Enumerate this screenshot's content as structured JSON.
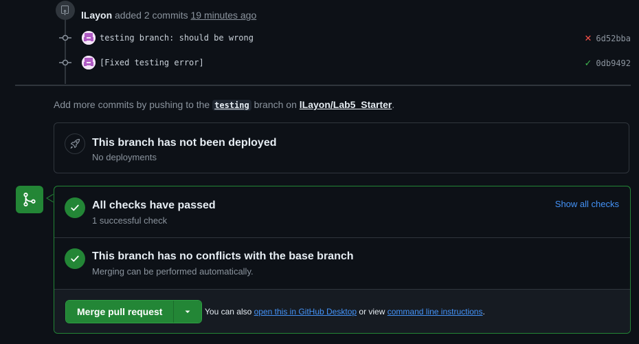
{
  "timeline": {
    "user": "lLayon",
    "action": "added 2 commits",
    "time": "19 minutes ago",
    "commits": [
      {
        "message": "testing branch: should be wrong",
        "status": "fail",
        "status_glyph": "✕",
        "status_color": "#f85149",
        "sha": "6d52bba"
      },
      {
        "message": "[Fixed testing error]",
        "status": "success",
        "status_glyph": "✓",
        "status_color": "#3fb950",
        "sha": "0db9492"
      }
    ]
  },
  "hint": {
    "prefix": "Add more commits by pushing to the",
    "branch": "testing",
    "middle": "branch on",
    "repo": "lLayon/Lab5_Starter",
    "suffix": "."
  },
  "deployment": {
    "icon": "rocket-icon",
    "title": "This branch has not been deployed",
    "subtitle": "No deployments"
  },
  "merge": {
    "badge_icon": "git-merge-icon",
    "checks": {
      "icon": "check-icon",
      "title": "All checks have passed",
      "subtitle": "1 successful check",
      "link": "Show all checks"
    },
    "conflicts": {
      "icon": "check-icon",
      "title": "This branch has no conflicts with the base branch",
      "subtitle": "Merging can be performed automatically."
    },
    "footer": {
      "button_label": "Merge pull request",
      "dropdown_icon": "triangle-down-icon",
      "text_prefix": "You can also",
      "desktop_link": "open this in GitHub Desktop",
      "text_middle": "or view",
      "cli_link": "command line instructions",
      "text_suffix": "."
    }
  },
  "colors": {
    "accent_green": "#238636",
    "link_blue": "#4493f8",
    "border": "#30363d",
    "background": "#0d1117"
  }
}
